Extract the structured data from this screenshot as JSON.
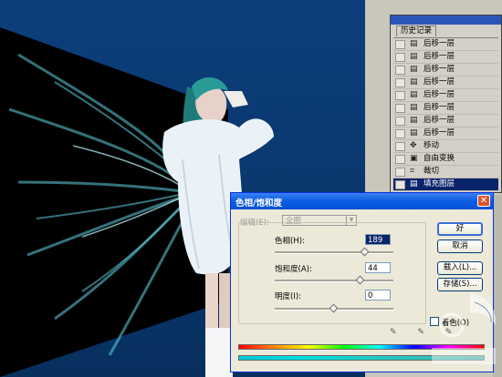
{
  "history": {
    "tab_label": "历史记录",
    "items": [
      {
        "label": "后移一层",
        "icon": "layer-icon"
      },
      {
        "label": "后移一层",
        "icon": "layer-icon"
      },
      {
        "label": "后移一层",
        "icon": "layer-icon"
      },
      {
        "label": "后移一层",
        "icon": "layer-icon"
      },
      {
        "label": "后移一层",
        "icon": "layer-icon"
      },
      {
        "label": "后移一层",
        "icon": "layer-icon"
      },
      {
        "label": "后移一层",
        "icon": "layer-icon"
      },
      {
        "label": "后移一层",
        "icon": "layer-icon"
      },
      {
        "label": "移动",
        "icon": "move-icon"
      },
      {
        "label": "自由变换",
        "icon": "transform-icon"
      },
      {
        "label": "裁切",
        "icon": "crop-icon"
      },
      {
        "label": "填充图层",
        "icon": "layer-icon",
        "selected": true
      }
    ]
  },
  "dialog": {
    "title": "色相/饱和度",
    "close_glyph": "✕",
    "edit_label": "编辑(E):",
    "edit_value": "全图",
    "hue_label": "色相(H):",
    "hue_value": "189",
    "saturation_label": "饱和度(A):",
    "saturation_value": "44",
    "lightness_label": "明度(I):",
    "lightness_value": "0",
    "ok_label": "好",
    "cancel_label": "取消",
    "load_label": "载入(L)...",
    "save_label": "存储(S)...",
    "colorize_label": "着色(O)",
    "eyedropper_glyphs": "✎ ✎ ✎"
  },
  "colors": {
    "canvas_bg": "#0b3a73",
    "dialog_title_blue": "#0a5ce0",
    "history_selected": "#0a246a"
  },
  "values": {
    "hue_slider": 0.76,
    "saturation_slider": 0.72,
    "lightness_slider": 0.5
  }
}
